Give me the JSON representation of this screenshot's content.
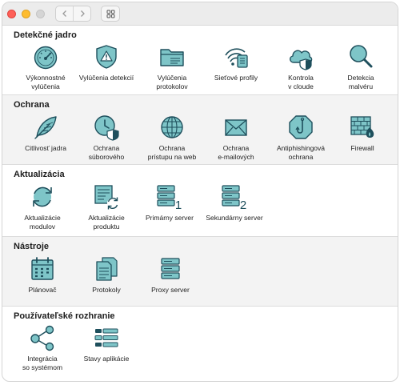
{
  "window": {
    "title": ""
  },
  "sections": [
    {
      "title": "Detekčné jadro",
      "items": [
        {
          "label": "Výkonnostné\nvylúčenia",
          "icon": "gauge-icon"
        },
        {
          "label": "Vylúčenia detekcií",
          "icon": "shield-warning-icon"
        },
        {
          "label": "Vylúčenia\nprotokolov",
          "icon": "folder-log-icon"
        },
        {
          "label": "Sieťové profily",
          "icon": "wifi-network-icon"
        },
        {
          "label": "Kontrola\nv cloude",
          "icon": "cloud-shield-icon"
        },
        {
          "label": "Detekcia\nmalvéru",
          "icon": "magnifier-icon"
        }
      ]
    },
    {
      "title": "Ochrana",
      "items": [
        {
          "label": "Citlivosť jadra",
          "icon": "feather-icon"
        },
        {
          "label": "Ochrana\nsúborového",
          "icon": "clock-shield-icon"
        },
        {
          "label": "Ochrana\nprístupu na web",
          "icon": "globe-icon"
        },
        {
          "label": "Ochrana\ne-mailových",
          "icon": "envelope-icon"
        },
        {
          "label": "Antiphishingová\nochrana",
          "icon": "hook-octagon-icon"
        },
        {
          "label": "Firewall",
          "icon": "firewall-icon"
        }
      ]
    },
    {
      "title": "Aktualizácia",
      "items": [
        {
          "label": "Aktualizácie\nmodulov",
          "icon": "refresh-icon"
        },
        {
          "label": "Aktualizácie\nproduktu",
          "icon": "product-update-icon"
        },
        {
          "label": "Primárny server",
          "icon": "server-1-icon"
        },
        {
          "label": "Sekundárny server",
          "icon": "server-2-icon"
        }
      ]
    },
    {
      "title": "Nástroje",
      "items": [
        {
          "label": "Plánovač",
          "icon": "calendar-icon"
        },
        {
          "label": "Protokoly",
          "icon": "documents-icon"
        },
        {
          "label": "Proxy server",
          "icon": "server-icon"
        }
      ]
    },
    {
      "title": "Používateľské rozhranie",
      "items": [
        {
          "label": "Integrácia\nso systémom",
          "icon": "share-nodes-icon"
        },
        {
          "label": "Stavy aplikácie",
          "icon": "status-list-icon"
        }
      ]
    }
  ],
  "colors": {
    "icon_fill": "#7ec5c8",
    "icon_stroke": "#1e4f5c",
    "accent": "#3d9aa6"
  }
}
